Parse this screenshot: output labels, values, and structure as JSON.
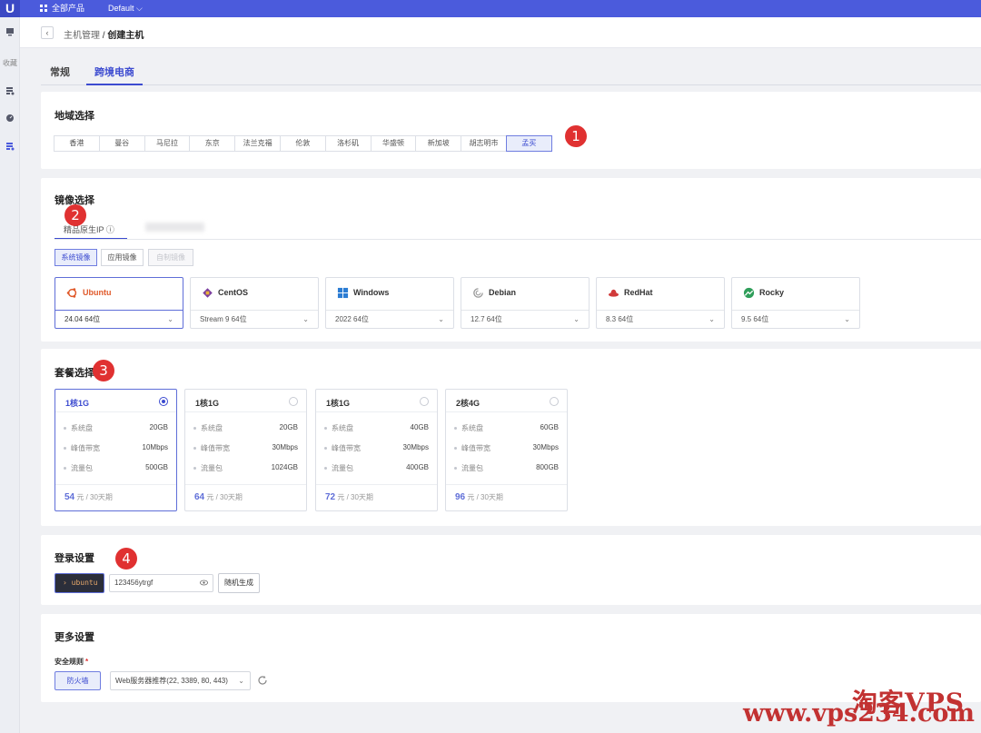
{
  "topbar": {
    "logo": "U",
    "products_label": "全部产品",
    "project_label": "Default ⌵"
  },
  "sidebar": {
    "collect_label": "收藏"
  },
  "breadcrumb": {
    "back": "‹",
    "parent": "主机管理",
    "sep": " / ",
    "current": "创建主机"
  },
  "tabs": [
    {
      "label": "常规"
    },
    {
      "label": "跨境电商",
      "active": true
    }
  ],
  "region": {
    "title": "地域选择",
    "items": [
      "香港",
      "曼谷",
      "马尼拉",
      "东京",
      "法兰克福",
      "伦敦",
      "洛杉矶",
      "华盛顿",
      "新加坡",
      "胡志明市",
      "孟买"
    ],
    "selected": "孟买"
  },
  "image": {
    "title": "镜像选择",
    "tab_label": "精品原生IP ⓘ",
    "segments": [
      {
        "label": "系统镜像",
        "state": "active"
      },
      {
        "label": "应用镜像",
        "state": "normal"
      },
      {
        "label": "自制镜像",
        "state": "disabled"
      }
    ],
    "os": [
      {
        "name": "Ubuntu",
        "version": "24.04 64位",
        "icon": "ubuntu-icon",
        "color": "#e05a2b",
        "active": true
      },
      {
        "name": "CentOS",
        "version": "Stream 9 64位",
        "icon": "centos-icon",
        "color": "#7b3f9e"
      },
      {
        "name": "Windows",
        "version": "2022 64位",
        "icon": "windows-icon",
        "color": "#2b7cd3"
      },
      {
        "name": "Debian",
        "version": "12.7 64位",
        "icon": "debian-icon",
        "color": "#999999"
      },
      {
        "name": "RedHat",
        "version": "8.3 64位",
        "icon": "redhat-icon",
        "color": "#d13a3a"
      },
      {
        "name": "Rocky",
        "version": "9.5 64位",
        "icon": "rocky-icon",
        "color": "#2f9e5a"
      }
    ]
  },
  "plans": {
    "title": "套餐选择",
    "spec_labels": [
      "系统盘",
      "峰值带宽",
      "流量包"
    ],
    "price_unit": "元 / 30天期",
    "items": [
      {
        "name": "1核1G",
        "disk": "20GB",
        "bandwidth": "10Mbps",
        "traffic": "500GB",
        "price": "54",
        "selected": true
      },
      {
        "name": "1核1G",
        "disk": "20GB",
        "bandwidth": "30Mbps",
        "traffic": "1024GB",
        "price": "64"
      },
      {
        "name": "1核1G",
        "disk": "40GB",
        "bandwidth": "30Mbps",
        "traffic": "400GB",
        "price": "72"
      },
      {
        "name": "2核4G",
        "disk": "60GB",
        "bandwidth": "30Mbps",
        "traffic": "800GB",
        "price": "96"
      }
    ]
  },
  "login": {
    "title": "登录设置",
    "username": "› ubuntu",
    "password": "123456ytrgf",
    "generate_label": "随机生成"
  },
  "more": {
    "title": "更多设置",
    "security_label": "安全规则",
    "required_mark": "*",
    "firewall_label": "防火墙",
    "rule_value": "Web服务器推荐(22, 3389, 80, 443)"
  },
  "badges": [
    "1",
    "2",
    "3",
    "4"
  ],
  "watermark": {
    "text": "淘客VPS",
    "url": "www.vps234.com"
  }
}
